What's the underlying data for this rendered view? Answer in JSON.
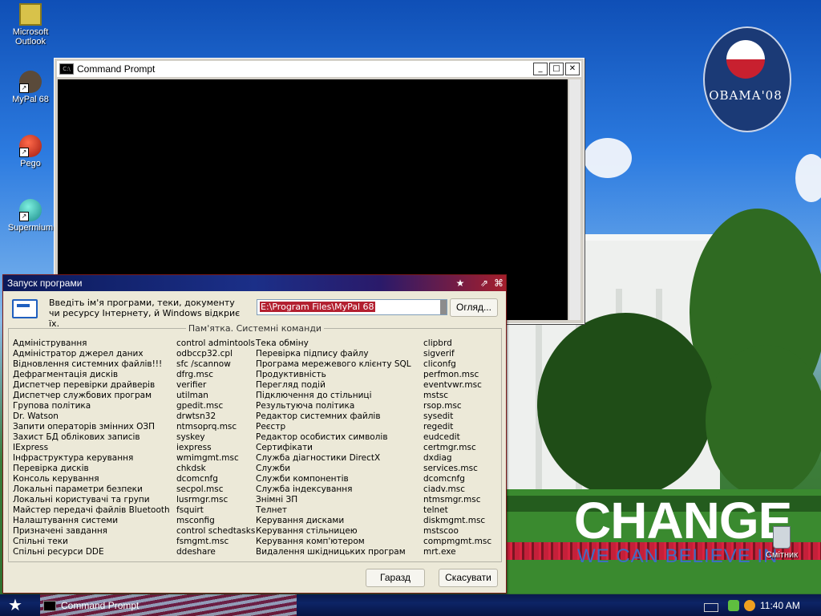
{
  "desktop": {
    "icons": [
      {
        "label": "Microsoft Outlook",
        "icon": "outlook-icon"
      },
      {
        "label": "MyPal 68",
        "icon": "mypal-icon"
      },
      {
        "label": "Pego",
        "icon": "pego-icon"
      },
      {
        "label": "Supermium",
        "icon": "supermium-icon"
      },
      {
        "label": "Смітник",
        "icon": "recycle-bin-icon"
      }
    ],
    "wallpaper": {
      "seal_text": "OBAMA'08",
      "headline": "CHANGE",
      "tagline": "WE CAN BELIEVE IN"
    }
  },
  "cmd_window": {
    "title": "Command Prompt",
    "controls": [
      "_",
      "□",
      "✕"
    ]
  },
  "run_dialog": {
    "title": "Запуск програми",
    "prompt": "Введіть ім'я програми, теки, документу чи ресурсу Інтернету, й Windows відкриє їх.",
    "input_value": "E:\\Program Files\\MyPal 68",
    "browse_label": "Огляд...",
    "memo_title": "Пам'ятка. Системні команди",
    "columns": [
      [
        "Адміністрування",
        "Адміністратор джерел даних",
        "Відновлення системних файлів!!!",
        "Дефрагментація дисків",
        "Диспетчер перевірки драйверів",
        "Диспетчер службових програм",
        "Групова політика",
        "Dr. Watson",
        "Запити операторів змінних ОЗП",
        "Захист БД облікових записів",
        "IExpress",
        "Інфраструктура керування",
        "Перевірка дисків",
        "Консоль керування",
        "Локальні параметри безпеки",
        "Локальні користувачі та групи",
        "Майстер передачі файлів Bluetooth",
        "Налаштування системи",
        "Призначені завдання",
        "Спільні теки",
        "Спільні ресурси DDE"
      ],
      [
        "control admintools",
        "odbccp32.cpl",
        "sfc /scannow",
        "dfrg.msc",
        "verifier",
        "utilman",
        "gpedit.msc",
        "drwtsn32",
        "ntmsoprq.msc",
        "syskey",
        "iexpress",
        "wmimgmt.msc",
        "chkdsk",
        "dcomcnfg",
        "secpol.msc",
        "lusrmgr.msc",
        "fsquirt",
        "msconfig",
        "control schedtasks",
        "fsmgmt.msc",
        "ddeshare"
      ],
      [
        "Тека обміну",
        "Перевірка підпису файлу",
        "Програма мережевого клієнту SQL",
        "Продуктивність",
        "Перегляд подій",
        "Підключення до стільниці",
        "Результуюча політика",
        "Редактор системних файлів",
        "Реєстр",
        "Редактор особистих символів",
        "Сертифікати",
        "Служба діагностики DirectX",
        "Служби",
        "Служби компонентів",
        "Служба індексування",
        "Знімні ЗП",
        "Телнет",
        "Керування дисками",
        "Керування стільницею",
        "Керування комп'ютером",
        "Видалення шкідницьких програм"
      ],
      [
        "clipbrd",
        "sigverif",
        "cliconfg",
        "perfmon.msc",
        "eventvwr.msc",
        "mstsc",
        "rsop.msc",
        "sysedit",
        "regedit",
        "eudcedit",
        "certmgr.msc",
        "dxdiag",
        "services.msc",
        "dcomcnfg",
        "ciadv.msc",
        "ntmsmgr.msc",
        "telnet",
        "diskmgmt.msc",
        "mstscoo",
        "compmgmt.msc",
        "mrt.exe"
      ]
    ],
    "ok_label": "Гаразд",
    "cancel_label": "Скасувати"
  },
  "taskbar": {
    "task_label": "Command Prompt",
    "clock": "11:40 AM"
  }
}
